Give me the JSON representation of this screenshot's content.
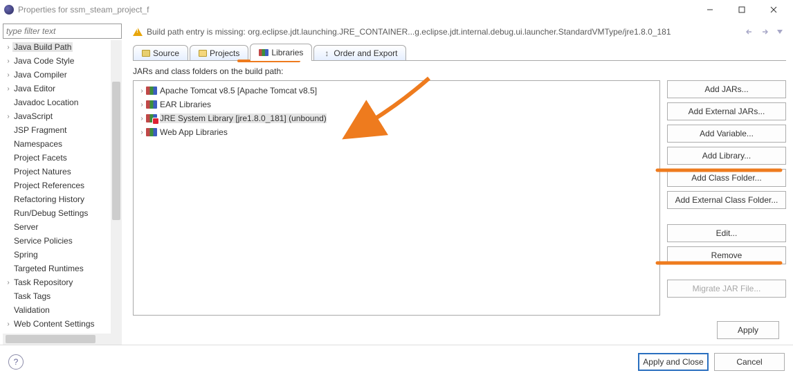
{
  "window": {
    "title": "Properties for ssm_steam_project_f",
    "filter_placeholder": "type filter text"
  },
  "sidebar": [
    {
      "label": "Java Build Path",
      "expandable": true,
      "selected": true
    },
    {
      "label": "Java Code Style",
      "expandable": true
    },
    {
      "label": "Java Compiler",
      "expandable": true
    },
    {
      "label": "Java Editor",
      "expandable": true
    },
    {
      "label": "Javadoc Location"
    },
    {
      "label": "JavaScript",
      "expandable": true
    },
    {
      "label": "JSP Fragment"
    },
    {
      "label": "Namespaces"
    },
    {
      "label": "Project Facets"
    },
    {
      "label": "Project Natures"
    },
    {
      "label": "Project References"
    },
    {
      "label": "Refactoring History"
    },
    {
      "label": "Run/Debug Settings"
    },
    {
      "label": "Server"
    },
    {
      "label": "Service Policies"
    },
    {
      "label": "Spring"
    },
    {
      "label": "Targeted Runtimes"
    },
    {
      "label": "Task Repository",
      "expandable": true
    },
    {
      "label": "Task Tags"
    },
    {
      "label": "Validation"
    },
    {
      "label": "Web Content Settings",
      "expandable": true
    }
  ],
  "warning": "Build path entry is missing: org.eclipse.jdt.launching.JRE_CONTAINER...g.eclipse.jdt.internal.debug.ui.launcher.StandardVMType/jre1.8.0_181",
  "tabs": [
    {
      "label": "Source",
      "icon": "src"
    },
    {
      "label": "Projects",
      "icon": "proj"
    },
    {
      "label": "Libraries",
      "icon": "lib",
      "active": true
    },
    {
      "label": "Order and Export",
      "icon": "exp"
    }
  ],
  "libs_heading": "JARs and class folders on the build path:",
  "libs": [
    {
      "label": "Apache Tomcat v8.5 [Apache Tomcat v8.5]"
    },
    {
      "label": "EAR Libraries"
    },
    {
      "label": "JRE System Library [jre1.8.0_181] (unbound)",
      "selected": true,
      "error": true
    },
    {
      "label": "Web App Libraries"
    }
  ],
  "buttons": {
    "add_jars": "Add JARs...",
    "add_ext_jars": "Add External JARs...",
    "add_variable": "Add Variable...",
    "add_library": "Add Library...",
    "add_class_folder": "Add Class Folder...",
    "add_ext_class_folder": "Add External Class Folder...",
    "edit": "Edit...",
    "remove": "Remove",
    "migrate": "Migrate JAR File...",
    "apply": "Apply",
    "apply_close": "Apply and Close",
    "cancel": "Cancel"
  },
  "anno_color": "#ee7b1e"
}
